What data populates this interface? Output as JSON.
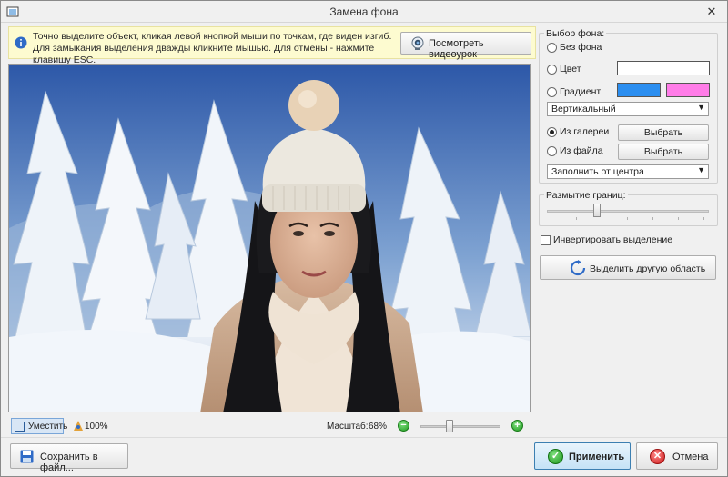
{
  "window": {
    "title": "Замена фона"
  },
  "hint": {
    "text": "Точно выделите объект, кликая левой кнопкой мыши по точкам, где виден изгиб. Для замыкания выделения дважды кликните мышью. Для отмены - нажмите клавишу ESC.",
    "video_button": "Посмотреть видеоурок"
  },
  "zoom": {
    "fit_label": "Уместить",
    "actual_label": "100%",
    "scale_label": "Масштаб:",
    "scale_value": "68%",
    "scale_percent": 68
  },
  "background": {
    "group_title": "Выбор фона:",
    "options": {
      "none": "Без фона",
      "color": "Цвет",
      "gradient": "Градиент",
      "gallery": "Из галереи",
      "file": "Из файла"
    },
    "selected": "gallery",
    "color_value": "#ffffff",
    "gradient_start": "#2b8ef0",
    "gradient_end": "#ff7ce8",
    "gradient_direction": "Вертикальный",
    "gallery_button": "Выбрать",
    "file_button": "Выбрать",
    "fill_mode": "Заполнить от центра"
  },
  "blur": {
    "group_title": "Размытие границ:",
    "level_fraction": 0.32
  },
  "invert": {
    "label": "Инвертировать выделение",
    "checked": false
  },
  "select_other_button": "Выделить другую область",
  "footer": {
    "save_button": "Сохранить в файл...",
    "apply_button": "Применить",
    "cancel_button": "Отмена"
  },
  "icons": {
    "app": "app-icon",
    "info": "info-icon",
    "webcam": "webcam-icon",
    "fit": "fit-icon",
    "actual": "actual-size-icon",
    "save": "floppy-disk-icon",
    "apply": "check-icon",
    "cancel": "x-icon",
    "select_other": "refresh-icon"
  }
}
